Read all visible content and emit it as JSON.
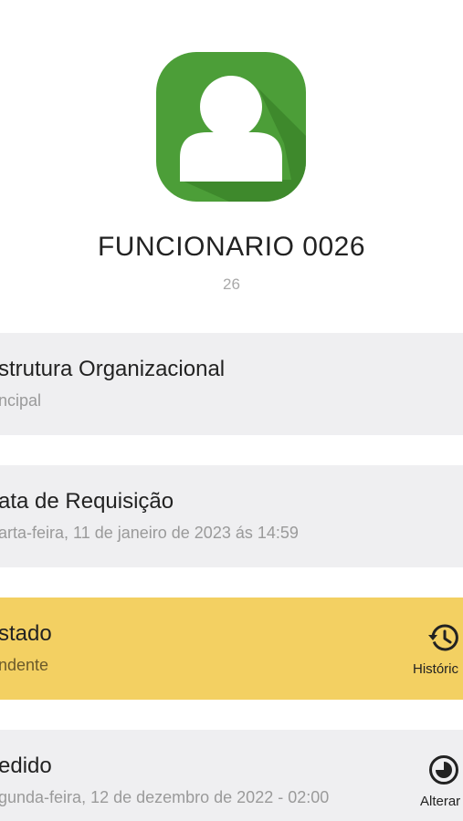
{
  "employee": {
    "name": "FUNCIONARIO 0026",
    "code": "26"
  },
  "cards": [
    {
      "title": "strutura Organizacional",
      "subtitle": "ncipal"
    },
    {
      "title": "ata de Requisição",
      "subtitle": "arta-feira, 11 de janeiro de 2023 ás 14:59"
    },
    {
      "title": "stado",
      "subtitle": "ndente",
      "action_label": "Históric",
      "action_icon": "history-icon"
    },
    {
      "title": "edido",
      "subtitle": "gunda-feira, 12 de dezembro de 2022 - 02:00",
      "action_label": "Alterar",
      "action_icon": "timer-icon"
    }
  ],
  "colors": {
    "avatar_green": "#4a9b35",
    "card_gray": "#efeff1",
    "status_yellow": "#f3d062"
  }
}
